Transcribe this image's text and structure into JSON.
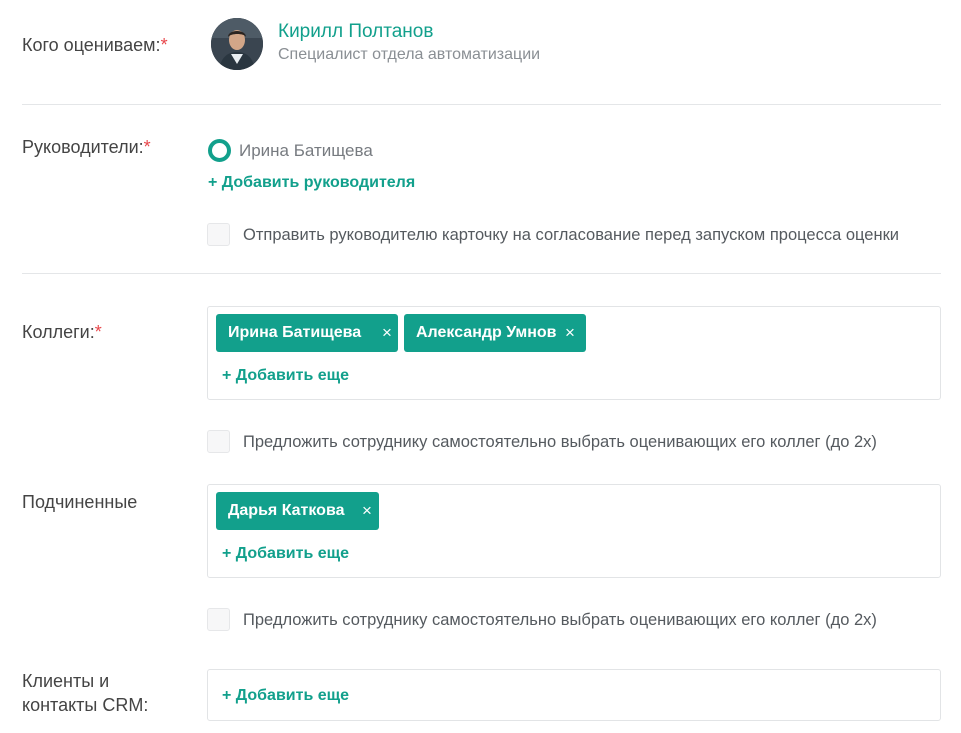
{
  "evaluatee": {
    "label": "Кого оцениваем:",
    "required_mark": "*",
    "name": "Кирилл Полтанов",
    "role": "Специалист отдела автоматизации"
  },
  "managers": {
    "label": "Руководители:",
    "required_mark": "*",
    "selected": "Ирина Батищева",
    "add_plus": "+",
    "add_label": "Добавить руководителя",
    "approval_checkbox_label": "Отправить руководителю карточку на согласование перед запуском процесса оценки",
    "approval_checked": false
  },
  "colleagues": {
    "label": "Коллеги:",
    "required_mark": "*",
    "tags": [
      "Ирина Батищева",
      "Александр Умнов"
    ],
    "remove_symbol": "×",
    "add_plus": "+",
    "add_label": "Добавить еще",
    "self_select_label": "Предложить сотруднику самостоятельно выбрать оценивающих его коллег (до 2х)",
    "self_select_checked": false
  },
  "subordinates": {
    "label": "Подчиненные",
    "tags": [
      "Дарья Каткова"
    ],
    "remove_symbol": "×",
    "add_plus": "+",
    "add_label": "Добавить еще",
    "self_select_label": "Предложить сотруднику самостоятельно выбрать оценивающих его коллег (до 2х)",
    "self_select_checked": false
  },
  "clients": {
    "label_line1": "Клиенты и",
    "label_line2": "контакты CRM:",
    "add_plus": "+",
    "add_label": "Добавить еще"
  },
  "colors": {
    "accent": "#12a08c",
    "required": "#e8464a"
  }
}
